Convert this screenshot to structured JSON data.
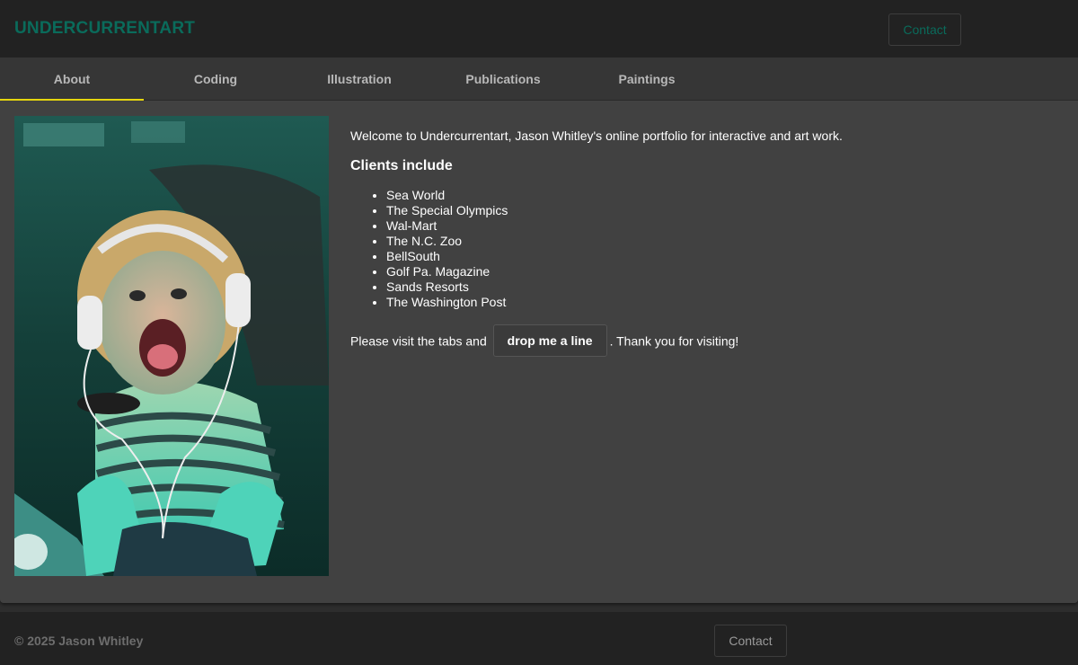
{
  "header": {
    "brand": "UNDERCURRENTART",
    "contact_label": "Contact"
  },
  "tabs": [
    {
      "label": "About",
      "active": true
    },
    {
      "label": "Coding",
      "active": false
    },
    {
      "label": "Illustration",
      "active": false
    },
    {
      "label": "Publications",
      "active": false
    },
    {
      "label": "Paintings",
      "active": false
    }
  ],
  "about": {
    "intro": "Welcome to Undercurrentart, Jason Whitley's online portfolio for interactive and art work.",
    "clients_heading": "Clients include",
    "clients": [
      "Sea World",
      "The Special Olympics",
      "Wal-Mart",
      "The N.C. Zoo",
      "BellSouth",
      "Golf Pa. Magazine",
      "Sands Resorts",
      "The Washington Post"
    ],
    "closing_before": "Please visit the tabs and",
    "drop_button": "drop me a line",
    "closing_after": ". Thank you for visiting!"
  },
  "footer": {
    "copyright": "© 2025 Jason Whitley",
    "contact_label": "Contact"
  },
  "colors": {
    "brand": "#0a6b5b",
    "active_tab_indicator": "#e8d80f",
    "card_background": "#414141"
  }
}
